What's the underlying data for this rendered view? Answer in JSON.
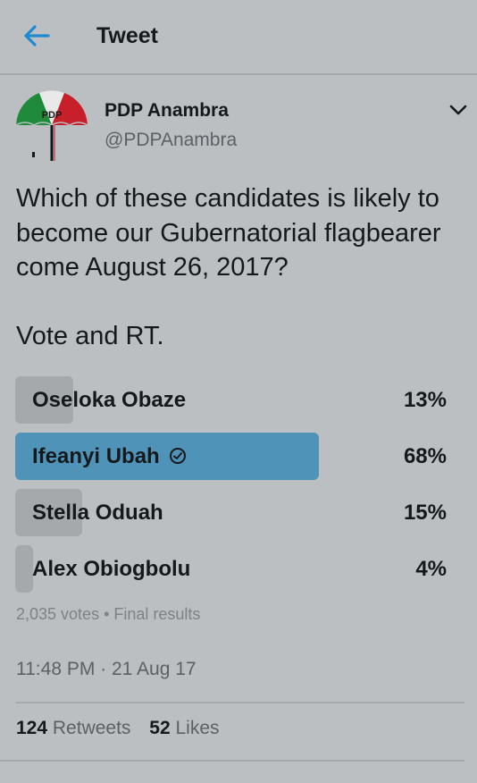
{
  "header": {
    "title": "Tweet",
    "back_icon": "arrow-left-icon"
  },
  "colors": {
    "accent": "#1d8ad1",
    "poll_winner": "#4f93b8",
    "poll_bar": "#a5a9ac",
    "background": "#bcbfc1"
  },
  "author": {
    "name": "PDP Anambra",
    "handle": "@PDPAnambra",
    "avatar_text": "PDP",
    "menu_icon": "chevron-down-icon"
  },
  "tweet": {
    "line1": "Which of these candidates is likely to become our Gubernatorial flagbearer come August 26, 2017?",
    "line2": "Vote and RT."
  },
  "poll": {
    "options": [
      {
        "label": "Oseloka Obaze",
        "percent_label": "13%",
        "percent": 13,
        "winner": false
      },
      {
        "label": "Ifeanyi Ubah",
        "percent_label": "68%",
        "percent": 68,
        "winner": true
      },
      {
        "label": "Stella Oduah",
        "percent_label": "15%",
        "percent": 15,
        "winner": false
      },
      {
        "label": "Alex Obiogbolu",
        "percent_label": "4%",
        "percent": 4,
        "winner": false
      }
    ],
    "meta": "2,035 votes • Final results"
  },
  "timestamp": "11:48 PM · 21 Aug 17",
  "stats": {
    "retweets_count": "124",
    "retweets_label": "Retweets",
    "likes_count": "52",
    "likes_label": "Likes"
  }
}
